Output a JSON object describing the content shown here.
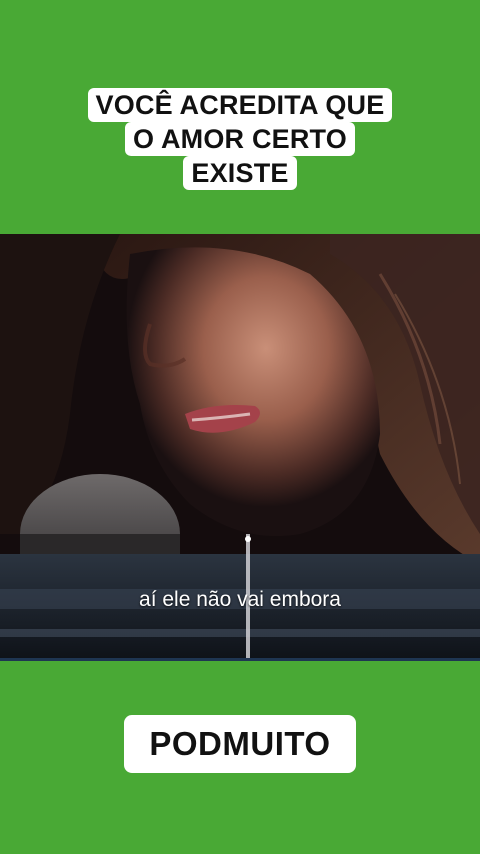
{
  "caption": {
    "lines": [
      "VOCÊ ACREDITA QUE",
      "O AMOR CERTO",
      "EXISTE"
    ]
  },
  "video": {
    "subtitle": "aí ele não vai embora"
  },
  "brand": {
    "label": "PODMUITO"
  },
  "colors": {
    "background": "#49a935",
    "caption_bg": "#ffffff",
    "caption_text": "#111111"
  }
}
